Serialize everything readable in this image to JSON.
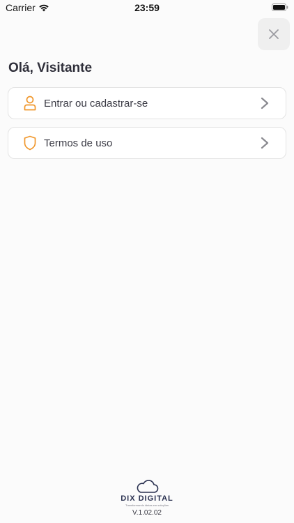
{
  "status_bar": {
    "carrier": "Carrier",
    "time": "23:59"
  },
  "header": {
    "close_icon": "close-icon"
  },
  "greeting": "Olá, Visitante",
  "menu": [
    {
      "label": "Entrar ou cadastrar-se",
      "icon": "user-icon"
    },
    {
      "label": "Termos de uso",
      "icon": "shield-icon"
    }
  ],
  "footer": {
    "brand_name": "DIX DIGITAL",
    "tagline": "Transformando ideias em soluções",
    "version": "V.1.02.02"
  },
  "colors": {
    "accent": "#f0962a",
    "chevron": "#8a8a90",
    "brand": "#2a3150"
  }
}
